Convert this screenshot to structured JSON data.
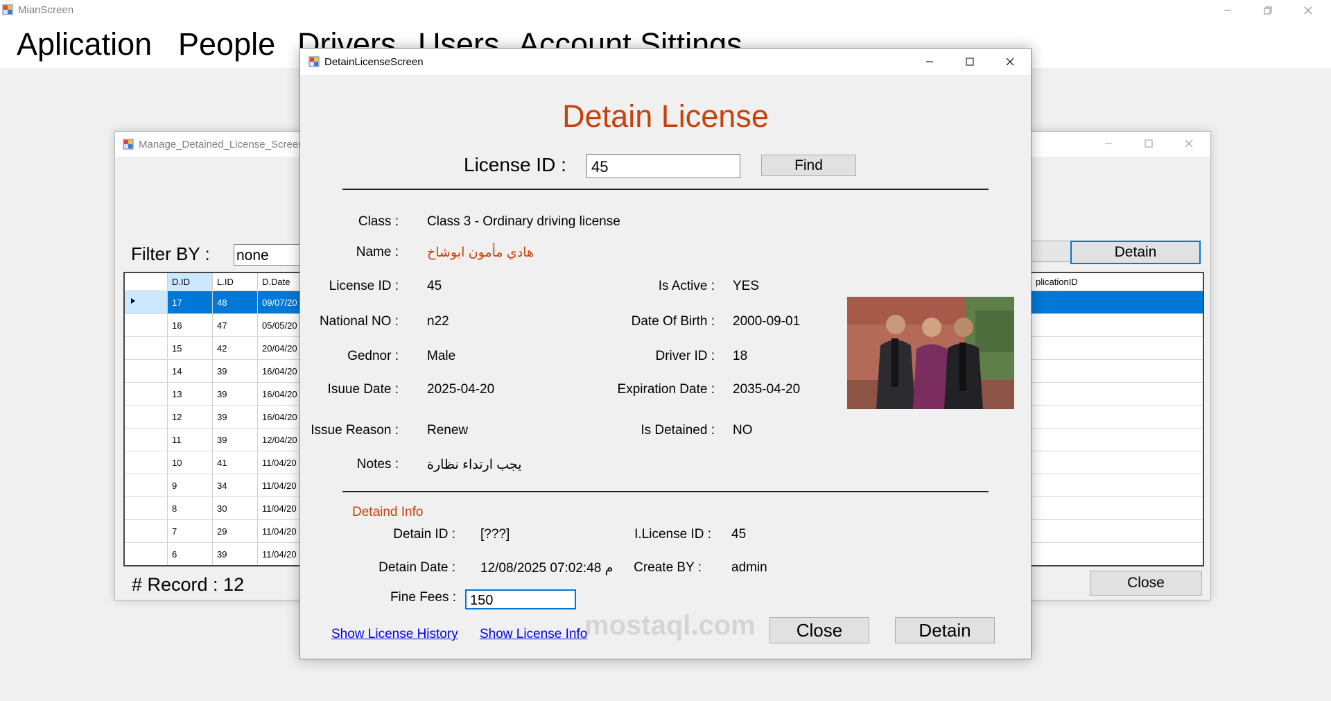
{
  "main_window": {
    "title": "MianScreen",
    "menu": [
      "Aplication",
      "People",
      "Drivers",
      "Users",
      "Account Sittings"
    ]
  },
  "manage_window": {
    "title": "Manage_Detained_License_Screen",
    "filter_label": "Filter BY :",
    "filter_value": "none",
    "detain_button": "Detain",
    "close_button": "Close",
    "record_label": "# Record :  12",
    "grid": {
      "columns": [
        "D.ID",
        "L.ID",
        "D.Date",
        "plicationID"
      ],
      "rows": [
        {
          "did": "17",
          "lid": "48",
          "date": "09/07/20",
          "selected": true
        },
        {
          "did": "16",
          "lid": "47",
          "date": "05/05/20"
        },
        {
          "did": "15",
          "lid": "42",
          "date": "20/04/20"
        },
        {
          "did": "14",
          "lid": "39",
          "date": "16/04/20"
        },
        {
          "did": "13",
          "lid": "39",
          "date": "16/04/20"
        },
        {
          "did": "12",
          "lid": "39",
          "date": "16/04/20"
        },
        {
          "did": "11",
          "lid": "39",
          "date": "12/04/20"
        },
        {
          "did": "10",
          "lid": "41",
          "date": "11/04/20"
        },
        {
          "did": "9",
          "lid": "34",
          "date": "11/04/20"
        },
        {
          "did": "8",
          "lid": "30",
          "date": "11/04/20"
        },
        {
          "did": "7",
          "lid": "29",
          "date": "11/04/20"
        },
        {
          "did": "6",
          "lid": "39",
          "date": "11/04/20"
        }
      ]
    }
  },
  "dialog": {
    "title": "DetainLicenseScreen",
    "heading": "Detain License",
    "license_id_label": "License ID :",
    "license_id_value": "45",
    "find_button": "Find",
    "info": {
      "class_label": "Class :",
      "class_value": "Class 3 - Ordinary driving license",
      "name_label": "Name :",
      "name_value": "هادي مأمون ابوشاخ",
      "license_id_label": "License ID :",
      "license_id_value": "45",
      "is_active_label": "Is Active :",
      "is_active_value": "YES",
      "national_no_label": "National NO :",
      "national_no_value": "n22",
      "dob_label": "Date Of Birth :",
      "dob_value": "2000-09-01",
      "gender_label": "Gednor :",
      "gender_value": "Male",
      "driver_id_label": "Driver ID :",
      "driver_id_value": "18",
      "issue_date_label": "Isuue Date :",
      "issue_date_value": "2025-04-20",
      "expiration_label": "Expiration Date :",
      "expiration_value": "2035-04-20",
      "issue_reason_label": "Issue Reason :",
      "issue_reason_value": "Renew",
      "is_detained_label": "Is Detained :",
      "is_detained_value": "NO",
      "notes_label": "Notes :",
      "notes_value": "يجب ارتداء نظارة"
    },
    "detain_info": {
      "section_title": "Detaind Info",
      "detain_id_label": "Detain ID  :",
      "detain_id_value": "[???]",
      "ilicense_label": "I.License ID  :",
      "ilicense_value": "45",
      "detain_date_label": "Detain Date  :",
      "detain_date_value": "12/08/2025 07:02:48 م",
      "create_by_label": "Create BY :",
      "create_by_value": "admin",
      "fine_fees_label": "Fine Fees :",
      "fine_fees_value": "150"
    },
    "links": {
      "history": "Show License History",
      "info": "Show License Info"
    },
    "close_button": "Close",
    "detain_button": "Detain"
  },
  "watermark": "mostaql.com",
  "colors": {
    "accent_orange": "#c8410a",
    "selection_blue": "#0078d7",
    "link_blue": "#0000ee"
  }
}
